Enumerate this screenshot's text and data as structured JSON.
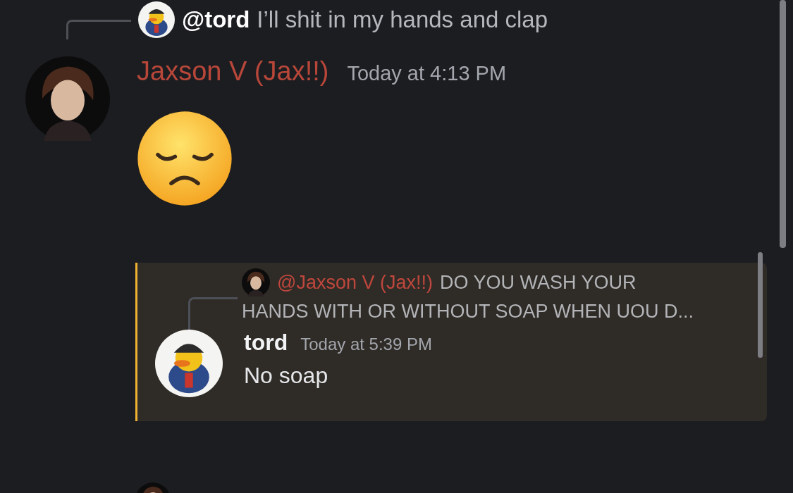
{
  "reply_preview": {
    "mention": "@tord",
    "text": "I’ll shit in my hands and clap"
  },
  "message": {
    "author": "Jaxson V (Jax!!)",
    "timestamp": "Today at 4:13 PM"
  },
  "highlighted_message": {
    "reply_preview": {
      "mention": "@Jaxson V (Jax!!)",
      "text_lines": [
        "DO YOU WASH YOUR",
        "HANDS WITH OR WITHOUT SOAP WHEN UOU D..."
      ]
    },
    "author": "tord",
    "timestamp": "Today at 5:39 PM",
    "text": "No soap"
  }
}
